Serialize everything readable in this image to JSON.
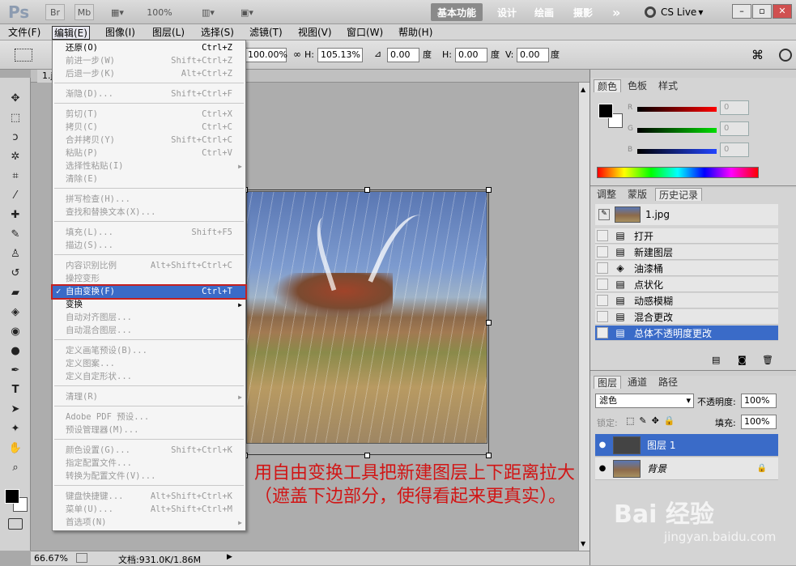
{
  "titlebar": {
    "logo": "Ps",
    "icons": [
      "Br",
      "Mb"
    ],
    "zoom": "100%",
    "workspaces": [
      "基本功能",
      "设计",
      "绘画",
      "摄影"
    ],
    "more": "»",
    "cslive": "CS Live",
    "win_min": "–",
    "win_max": "▫",
    "win_close": "✕"
  },
  "menubar": [
    "文件(F)",
    "编辑(E)",
    "图像(I)",
    "图层(L)",
    "选择(S)",
    "滤镜(T)",
    "视图(V)",
    "窗口(W)",
    "帮助(H)"
  ],
  "options": {
    "w_value": "100.00%",
    "h_label": "H:",
    "h_value": "105.13%",
    "angle_value": "0.00",
    "deg1": "度",
    "hskew_label": "H:",
    "hskew_value": "0.00",
    "deg2": "度",
    "v_label": "V:",
    "v_value": "0.00",
    "deg3": "度"
  },
  "doc_tab": "1.jp",
  "edit_menu": [
    {
      "label": "还原(O)",
      "shortcut": "Ctrl+Z",
      "enabled": true
    },
    {
      "label": "前进一步(W)",
      "shortcut": "Shift+Ctrl+Z"
    },
    {
      "label": "后退一步(K)",
      "shortcut": "Alt+Ctrl+Z"
    },
    {
      "label": "渐隐(D)...",
      "shortcut": "Shift+Ctrl+F"
    },
    {
      "label": "剪切(T)",
      "shortcut": "Ctrl+X"
    },
    {
      "label": "拷贝(C)",
      "shortcut": "Ctrl+C"
    },
    {
      "label": "合并拷贝(Y)",
      "shortcut": "Shift+Ctrl+C"
    },
    {
      "label": "粘贴(P)",
      "shortcut": "Ctrl+V"
    },
    {
      "label": "选择性粘贴(I)",
      "shortcut": ""
    },
    {
      "label": "清除(E)",
      "shortcut": ""
    },
    {
      "label": "拼写检查(H)...",
      "shortcut": ""
    },
    {
      "label": "查找和替换文本(X)...",
      "shortcut": ""
    },
    {
      "label": "填充(L)...",
      "shortcut": "Shift+F5"
    },
    {
      "label": "描边(S)...",
      "shortcut": ""
    },
    {
      "label": "内容识别比例",
      "shortcut": "Alt+Shift+Ctrl+C"
    },
    {
      "label": "操控变形",
      "shortcut": ""
    },
    {
      "label": "自由变换(F)",
      "shortcut": "Ctrl+T",
      "checked": "✓"
    },
    {
      "label": "变换",
      "shortcut": ""
    },
    {
      "label": "自动对齐图层...",
      "shortcut": ""
    },
    {
      "label": "自动混合图层...",
      "shortcut": ""
    },
    {
      "label": "定义画笔预设(B)...",
      "shortcut": ""
    },
    {
      "label": "定义图案...",
      "shortcut": ""
    },
    {
      "label": "定义自定形状...",
      "shortcut": ""
    },
    {
      "label": "清理(R)",
      "shortcut": ""
    },
    {
      "label": "Adobe PDF 预设...",
      "shortcut": ""
    },
    {
      "label": "预设管理器(M)...",
      "shortcut": ""
    },
    {
      "label": "颜色设置(G)...",
      "shortcut": "Shift+Ctrl+K"
    },
    {
      "label": "指定配置文件...",
      "shortcut": ""
    },
    {
      "label": "转换为配置文件(V)...",
      "shortcut": ""
    },
    {
      "label": "键盘快捷键...",
      "shortcut": "Alt+Shift+Ctrl+K"
    },
    {
      "label": "菜单(U)...",
      "shortcut": "Alt+Shift+Ctrl+M"
    },
    {
      "label": "首选项(N)",
      "shortcut": ""
    }
  ],
  "color_panel": {
    "tabs": [
      "颜色",
      "色板",
      "样式"
    ],
    "r_label": "R",
    "g_label": "G",
    "b_label": "B",
    "r": "0",
    "g": "0",
    "b": "0"
  },
  "history_panel": {
    "tabs": [
      "调整",
      "蒙版",
      "历史记录"
    ],
    "snapshot": "1.jpg",
    "items": [
      "打开",
      "新建图层",
      "油漆桶",
      "点状化",
      "动感模糊",
      "混合更改",
      "总体不透明度更改"
    ]
  },
  "layers_panel": {
    "tabs": [
      "图层",
      "通道",
      "路径"
    ],
    "blend_mode": "滤色",
    "opacity_label": "不透明度:",
    "opacity": "100%",
    "lock_label": "锁定:",
    "fill_label": "填充:",
    "fill": "100%",
    "layers": [
      "图层 1",
      "背景"
    ]
  },
  "status": {
    "zoom": "66.67%",
    "doc": "文档:931.0K/1.86M"
  },
  "annotation": "用自由变换工具把新建图层上下距离拉大（遮盖下边部分，使得看起来更真实）。",
  "watermark": {
    "brand": "Bai 经验",
    "url": "jingyan.baidu.com"
  },
  "colors": {
    "highlight": "#3a6bc8",
    "annotation": "#d11515",
    "alert_frame": "#c42020"
  }
}
